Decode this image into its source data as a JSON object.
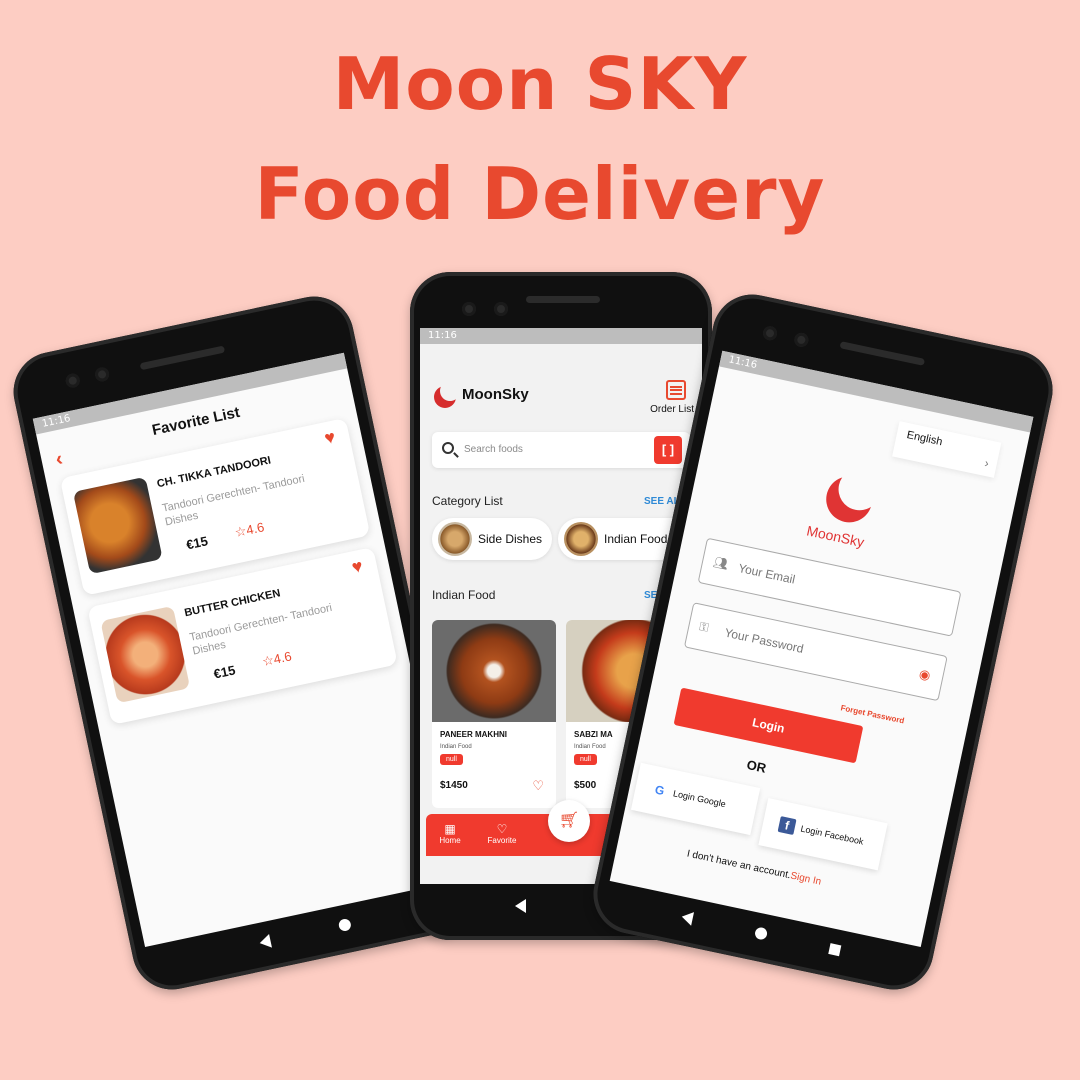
{
  "headline": {
    "line1": "Moon SKY",
    "line2": "Food Delivery"
  },
  "colors": {
    "accent": "#e8492f",
    "background": "#fdcdc3",
    "button": "#f03a2e",
    "link": "#2f8ad6"
  },
  "status_time": "11:16",
  "favorite_screen": {
    "title": "Favorite List",
    "back_icon": "chevron-left-icon",
    "items": [
      {
        "name": "CH. TIKKA TANDOORI",
        "subtitle": "Tandoori Gerechten- Tandoori Dishes",
        "price": "€15",
        "rating": "4.6"
      },
      {
        "name": "BUTTER CHICKEN",
        "subtitle": "Tandoori Gerechten- Tandoori Dishes",
        "price": "€15",
        "rating": "4.6"
      }
    ]
  },
  "home_screen": {
    "brand": "MoonSky",
    "order_label": "Order List",
    "search_placeholder": "Search foods",
    "scan_icon": "[ ]",
    "category_title": "Category List",
    "see_all": "SEE ALL",
    "categories": [
      {
        "label": "Side Dishes"
      },
      {
        "label": "Indian Food"
      }
    ],
    "section_title": "Indian Food",
    "section_see": "SE",
    "foods": [
      {
        "name": "PANEER MAKHNI",
        "category": "Indian Food",
        "tag": "null",
        "price": "$1450"
      },
      {
        "name": "SABZI MA",
        "category": "Indian Food",
        "tag": "null",
        "price": "$500"
      }
    ],
    "bottom_nav": [
      {
        "label": "Home",
        "icon": "grid-icon"
      },
      {
        "label": "Favorite",
        "icon": "heart-icon"
      }
    ],
    "cart_icon": "cart-icon"
  },
  "login_screen": {
    "language": "English",
    "brand": "MoonSky",
    "email_placeholder": "Your Email",
    "password_placeholder": "Your Password",
    "forget_password": "Forget Password",
    "login_label": "Login",
    "or_label": "OR",
    "google_label": "Login Google",
    "facebook_label": "Login Facebook",
    "signup_text": "I don't have an account.",
    "signup_link": "Sign In"
  }
}
